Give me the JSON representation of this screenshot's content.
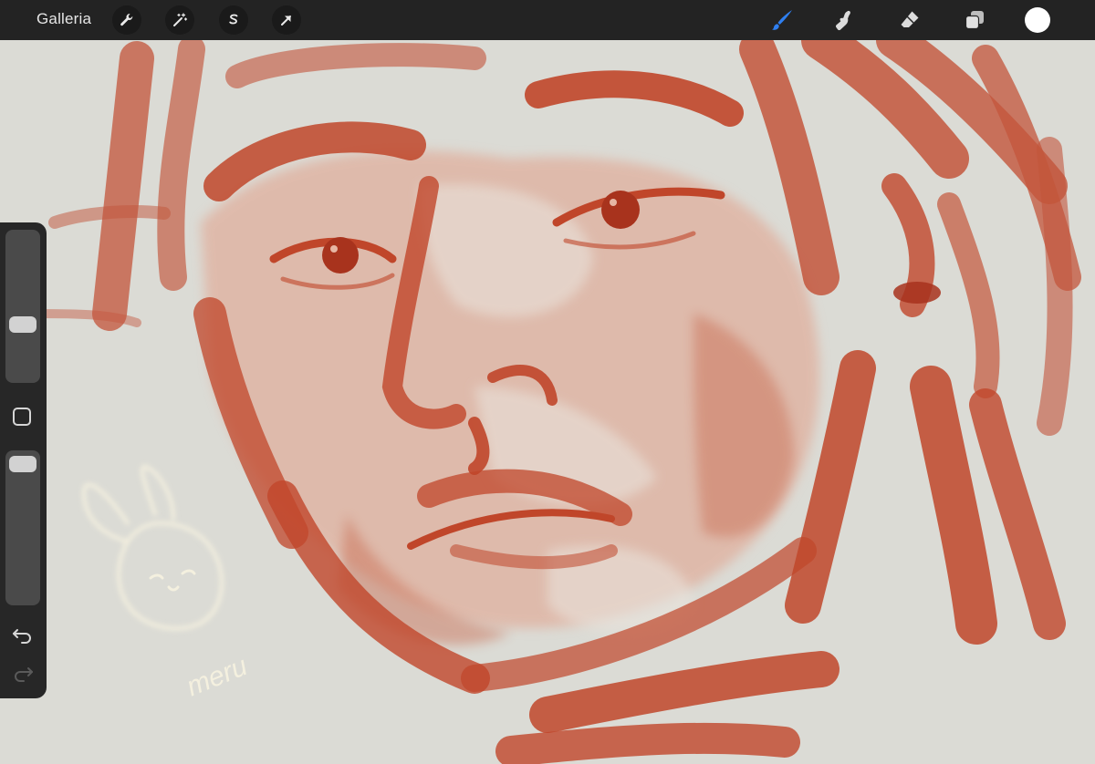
{
  "toolbar": {
    "gallery_label": "Galleria",
    "left_tools": [
      {
        "name": "actions",
        "icon": "wrench-icon"
      },
      {
        "name": "adjustments",
        "icon": "magic-wand-icon"
      },
      {
        "name": "selection",
        "icon": "selection-s-icon"
      },
      {
        "name": "transform",
        "icon": "arrow-cursor-icon"
      }
    ],
    "right_tools": [
      {
        "name": "brush",
        "icon": "brush-icon",
        "active": true
      },
      {
        "name": "smudge",
        "icon": "smudge-finger-icon"
      },
      {
        "name": "eraser",
        "icon": "eraser-icon"
      },
      {
        "name": "layers",
        "icon": "layers-icon"
      }
    ],
    "current_color": "#ffffff",
    "active_color": "#2f7ff0"
  },
  "sidebar": {
    "brush_size_level": 0.6,
    "opacity_level": 0.95,
    "modifier_icon": "square-modifier-icon",
    "undo_icon": "undo-arrow-icon",
    "redo_icon": "redo-arrow-icon"
  },
  "canvas": {
    "background_color": "#d9d9d4",
    "paint_color": "#c0462a",
    "signature": "meru"
  }
}
